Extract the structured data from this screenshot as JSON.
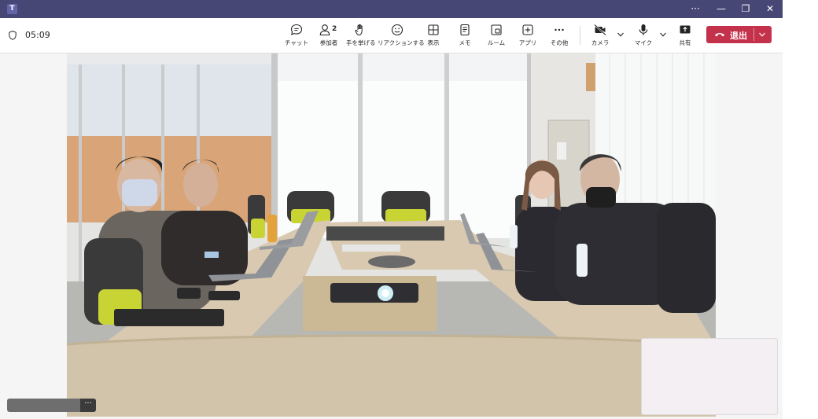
{
  "titlebar": {
    "app_logo": "T",
    "more_glyph": "···",
    "minimize_glyph": "—",
    "restore_glyph": "❐",
    "close_glyph": "✕"
  },
  "meeting": {
    "timer": "05:09"
  },
  "toolbar": {
    "chat_label": "チャット",
    "participants_label": "参加者",
    "participants_count": "2",
    "raise_hand_label": "手を挙げる",
    "react_label": "リアクションする",
    "view_label": "表示",
    "notes_label": "メモ",
    "rooms_label": "ルーム",
    "apps_label": "アプリ",
    "more_label": "その他",
    "camera_label": "カメラ",
    "mic_label": "マイク",
    "share_label": "共有",
    "leave_label": "退出"
  },
  "colors": {
    "titlebar": "#464775",
    "leave": "#c4314b",
    "chair_accent": "#c8d434"
  },
  "name_tag": {
    "more_glyph": "···"
  }
}
